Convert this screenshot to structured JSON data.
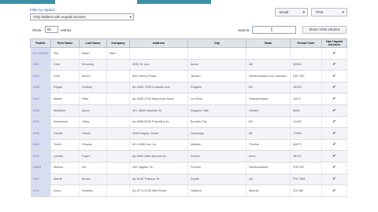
{
  "filter": {
    "label": "Filter by unpaid:",
    "selected": "Only bidders with unpaid invoices"
  },
  "toolbar": {
    "email_label": "Email",
    "print_label": "Print"
  },
  "controls": {
    "show_label": "Show",
    "show_value": "50",
    "entries_label": "entries",
    "search_label": "Search:",
    "search_value": "",
    "show_hide_label": "Show / Hide columns"
  },
  "table": {
    "headers": [
      "Paddle",
      "First Name",
      "Last Name",
      "Company",
      "Address",
      "City",
      "State",
      "Postal Code",
      "Has Unpaid Invoices"
    ],
    "rows": [
      [
        "NO CLIENT",
        "Tim",
        "Baker",
        "Mart",
        "",
        "",
        "",
        "",
        "✔"
      ],
      [
        "4011",
        "Cole",
        "Kennedy",
        "",
        "3995 St. ave",
        "Acme",
        "AB",
        "52361",
        "✔"
      ],
      [
        "2001",
        "Hunt",
        "Moore",
        "",
        "8923 Bonny Road",
        "Tamaro",
        "Newfoundland and Labrador",
        "Z4E 2B7",
        "✔"
      ],
      [
        "1003",
        "Regan",
        "Lindsay",
        "",
        "Ap #954-7008 Curabitur Ave",
        "Rugiano",
        "BC",
        "18139",
        "✔"
      ],
      [
        "0047",
        "Maldin",
        "Riley",
        "",
        "Ap #338-2759 Maecenas Road",
        "La Reina",
        "Saskatchewan",
        "31671",
        "✔"
      ],
      [
        "1004",
        "Madeline",
        "Acton",
        "",
        "491-9863 Nascetur St.",
        "Rugiano Calk",
        "Ontario",
        "6505",
        "✔"
      ],
      [
        "4375",
        "Nozomiere",
        "Yeats",
        "",
        "Ap #989-8099 Phasellus Av.",
        "Boulder City",
        "BC",
        "41108",
        "✔"
      ],
      [
        "1006",
        "Gerald",
        "Cheek",
        "",
        "2998 Magna, Street",
        "Hunsleigh",
        "MI",
        "77996",
        "✔"
      ],
      [
        "0004",
        "Tuello",
        "Rhoyes",
        "",
        "691-9986 Nec, Av.",
        "Malibue",
        "Thuriné",
        "63879",
        "✔"
      ],
      [
        "3002",
        "Lynsee",
        "Foyes",
        "",
        "Ap #362-4864 Aenean Av.",
        "Pedem",
        "Irene",
        "46102",
        "✔"
      ],
      [
        "15003",
        "Mellisa",
        "Siu",
        "",
        "440 Sagittis, St.",
        "Preston",
        "Newfoundland",
        "PHR B3",
        "✔"
      ],
      [
        "1037",
        "Merrill",
        "Brown",
        "",
        "Ap #128 Tristique St.",
        "Duluth",
        "QC",
        "PHY 828",
        "✔"
      ],
      [
        "1071",
        "Nona",
        "Delaney",
        "",
        "Ap #774-4226 Nibh Road",
        "Hartford",
        "Alberta",
        "Z0I 2B9",
        "✔"
      ]
    ]
  },
  "colors": {
    "tab_accent": "#3c8fa4",
    "header_bg": "#dfe3ea",
    "paddle_bg": "#d9ddf2",
    "link": "#2a64b3"
  }
}
